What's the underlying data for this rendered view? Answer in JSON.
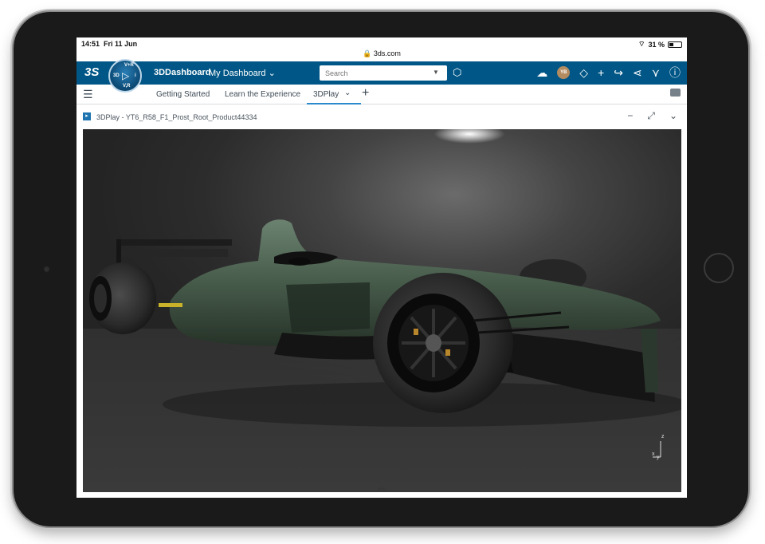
{
  "status_bar": {
    "time": "14:51",
    "date": "Fri 11 Jun",
    "url": "3ds.com",
    "battery": "31 %"
  },
  "app_bar": {
    "logo": "3S",
    "compass": {
      "top": "V+R",
      "left": "3D",
      "right": "i",
      "bottom": "V,R"
    },
    "brand": "3DDashboard",
    "dashboard_name": "My Dashboard",
    "search_placeholder": "Search",
    "avatar_initials": "YB"
  },
  "tabs": [
    {
      "label": "Getting Started",
      "active": false
    },
    {
      "label": "Learn the Experience",
      "active": false
    },
    {
      "label": "3DPlay",
      "active": true
    }
  ],
  "widget": {
    "title": "3DPlay - YT6_R58_F1_Prost_Root_Product44334"
  },
  "viewer": {
    "axis_labels": {
      "z": "z",
      "x": "x",
      "y": "y"
    }
  },
  "colors": {
    "app_bar": "#005686",
    "tab_active_underline": "#2b8acb",
    "car_body": "#4a5f4e"
  }
}
